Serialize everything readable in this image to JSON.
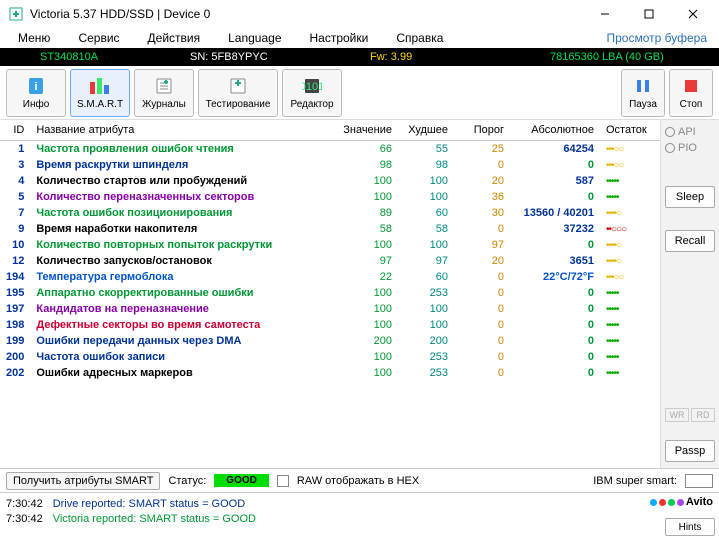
{
  "window": {
    "title": "Victoria 5.37 HDD/SSD | Device 0"
  },
  "menu": {
    "items": [
      "Меню",
      "Сервис",
      "Действия",
      "Language",
      "Настройки",
      "Справка"
    ],
    "right": "Просмотр буфера"
  },
  "devicebar": {
    "model": "ST340810A",
    "serial": "SN: 5FB8YPYC",
    "fw": "Fw: 3.99",
    "lba": "78165360 LBA (40 GB)"
  },
  "toolbar": {
    "info": "Инфо",
    "smart": "S.M.A.R.T",
    "logs": "Журналы",
    "test": "Тестирование",
    "editor": "Редактор",
    "pause": "Пауза",
    "stop": "Стоп"
  },
  "side": {
    "api": "API",
    "pio": "PIO",
    "sleep": "Sleep",
    "recall": "Recall",
    "wr": "WR",
    "rd": "RD",
    "passp": "Passp",
    "hints": "Hints"
  },
  "columns": {
    "id": "ID",
    "name": "Название атрибута",
    "val": "Значение",
    "worst": "Худшее",
    "thresh": "Порог",
    "abs": "Абсолютное",
    "rem": "Остаток"
  },
  "rows": [
    {
      "id": "1",
      "name": "Частота проявления ошибок чтения",
      "nc": "c-green",
      "val": "66",
      "worst": "55",
      "thresh": "25",
      "abs": "64254",
      "dots": "•••○○",
      "dc": "dots-yellow"
    },
    {
      "id": "3",
      "name": "Время раскрутки шпинделя",
      "nc": "c-navy",
      "val": "98",
      "worst": "98",
      "thresh": "0",
      "abs": "0",
      "dots": "•••○○",
      "dc": "dots-yellow"
    },
    {
      "id": "4",
      "name": "Количество стартов или пробуждений",
      "nc": "c-black",
      "val": "100",
      "worst": "100",
      "thresh": "20",
      "abs": "587",
      "dots": "•••••",
      "dc": "dots-green"
    },
    {
      "id": "5",
      "name": "Количество переназначенных секторов",
      "nc": "c-purple",
      "val": "100",
      "worst": "100",
      "thresh": "36",
      "abs": "0",
      "dots": "•••••",
      "dc": "dots-green"
    },
    {
      "id": "7",
      "name": "Частота ошибок позиционирования",
      "nc": "c-green",
      "val": "89",
      "worst": "60",
      "thresh": "30",
      "abs": "13560 / 40201",
      "dots": "••••○",
      "dc": "dots-yellow"
    },
    {
      "id": "9",
      "name": "Время наработки накопителя",
      "nc": "c-black",
      "val": "58",
      "worst": "58",
      "thresh": "0",
      "abs": "37232",
      "dots": "••○○○",
      "dc": "dots-red"
    },
    {
      "id": "10",
      "name": "Количество повторных попыток раскрутки",
      "nc": "c-green",
      "val": "100",
      "worst": "100",
      "thresh": "97",
      "abs": "0",
      "dots": "••••○",
      "dc": "dots-yellow"
    },
    {
      "id": "12",
      "name": "Количество запусков/остановок",
      "nc": "c-black",
      "val": "97",
      "worst": "97",
      "thresh": "20",
      "abs": "3651",
      "dots": "••••○",
      "dc": "dots-yellow"
    },
    {
      "id": "194",
      "name": "Температура гермоблока",
      "nc": "c-blue",
      "val": "22",
      "worst": "60",
      "thresh": "0",
      "abs": "22°C/72°F",
      "dots": "•••○○",
      "dc": "dots-yellow"
    },
    {
      "id": "195",
      "name": "Аппаратно скорректированные ошибки",
      "nc": "c-green",
      "val": "100",
      "worst": "253",
      "thresh": "0",
      "abs": "0",
      "dots": "•••••",
      "dc": "dots-green"
    },
    {
      "id": "197",
      "name": "Кандидатов на переназначение",
      "nc": "c-purple",
      "val": "100",
      "worst": "100",
      "thresh": "0",
      "abs": "0",
      "dots": "•••••",
      "dc": "dots-green"
    },
    {
      "id": "198",
      "name": "Дефектные секторы во время самотеста",
      "nc": "c-red",
      "val": "100",
      "worst": "100",
      "thresh": "0",
      "abs": "0",
      "dots": "•••••",
      "dc": "dots-green"
    },
    {
      "id": "199",
      "name": "Ошибки передачи данных через DMA",
      "nc": "c-navy",
      "val": "200",
      "worst": "200",
      "thresh": "0",
      "abs": "0",
      "dots": "•••••",
      "dc": "dots-green"
    },
    {
      "id": "200",
      "name": "Частота ошибок записи",
      "nc": "c-navy",
      "val": "100",
      "worst": "253",
      "thresh": "0",
      "abs": "0",
      "dots": "•••••",
      "dc": "dots-green"
    },
    {
      "id": "202",
      "name": "Ошибки адресных маркеров",
      "nc": "c-black",
      "val": "100",
      "worst": "253",
      "thresh": "0",
      "abs": "0",
      "dots": "•••••",
      "dc": "dots-green"
    }
  ],
  "status": {
    "getbtn": "Получить атрибуты SMART",
    "status_label": "Статус:",
    "good": "GOOD",
    "rawhex": "RAW отображать в HEX",
    "super": "IBM super smart:"
  },
  "log": {
    "t1": "7:30:42",
    "l1": "Drive reported: SMART status = GOOD",
    "t2": "7:30:42",
    "l2": "Victoria reported: SMART status = GOOD"
  },
  "watermark": "Avito"
}
